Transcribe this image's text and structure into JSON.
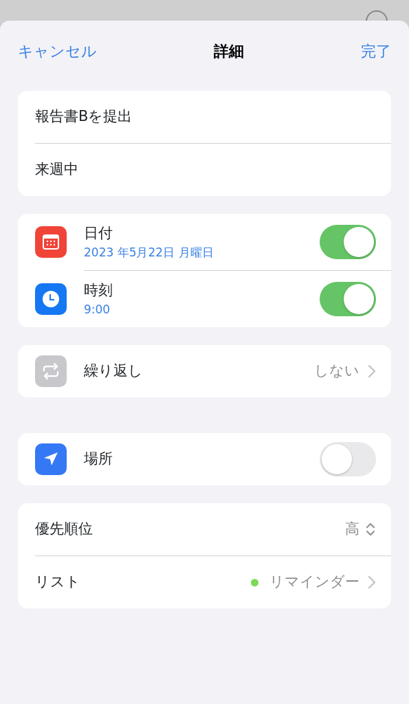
{
  "nav": {
    "cancel": "キャンセル",
    "title": "詳細",
    "done": "完了"
  },
  "task": {
    "title": "報告書Bを提出",
    "notes": "来週中"
  },
  "sections": [
    {
      "rows": [
        {
          "kind": "toggle",
          "label": "日付",
          "detail": "2023 年5月22日 月曜日",
          "on": true
        },
        {
          "kind": "toggle",
          "label": "時刻",
          "detail": "9:00",
          "on": true
        }
      ]
    },
    {
      "rows": [
        {
          "kind": "link",
          "label": "繰り返し",
          "value": "しない"
        }
      ]
    },
    {
      "rows": [
        {
          "kind": "toggle",
          "label": "場所",
          "on": false
        }
      ]
    },
    {
      "rows": [
        {
          "kind": "picker",
          "label": "優先順位",
          "value": "高"
        },
        {
          "kind": "link",
          "label": "リスト",
          "value": "リマインダー",
          "color": "#7ed957"
        }
      ]
    }
  ]
}
